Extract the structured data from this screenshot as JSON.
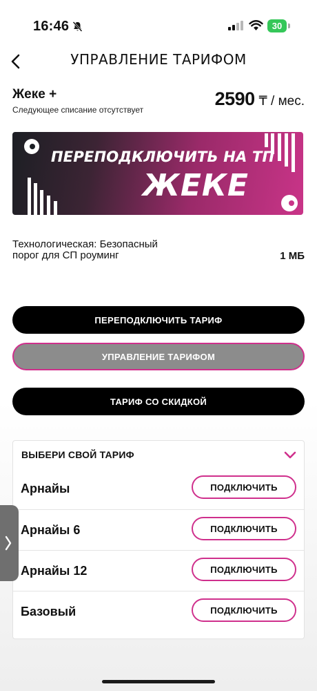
{
  "status_bar": {
    "time": "16:46",
    "battery": "30"
  },
  "header": {
    "title": "УПРАВЛЕНИЕ ТАРИФОМ"
  },
  "tariff": {
    "name": "Жеке +",
    "next_charge_note": "Следующее списание отсутствует",
    "price": "2590",
    "price_unit": "₸ / мес."
  },
  "banner": {
    "line1": "ПЕРЕПОДКЛЮЧИТЬ НА ТП",
    "line2": "ЖЕКЕ"
  },
  "tech_info": {
    "label": "Технологическая: Безопасный порог для СП роуминг",
    "value": "1 МБ"
  },
  "buttons": {
    "reconnect": "ПЕРЕПОДКЛЮЧИТЬ ТАРИФ",
    "manage": "УПРАВЛЕНИЕ ТАРИФОМ",
    "discount": "ТАРИФ СО СКИДКОЙ"
  },
  "choose_tariff": {
    "title": "ВЫБЕРИ СВОЙ ТАРИФ",
    "connect_label": "ПОДКЛЮЧИТЬ",
    "items": [
      {
        "name": "Арнайы"
      },
      {
        "name": "Арнайы 6"
      },
      {
        "name": "Арнайы 12"
      },
      {
        "name": "Базовый"
      }
    ]
  },
  "colors": {
    "accent": "#cf2f8c",
    "primary_button": "#000000",
    "disabled_button": "#8c8c8c",
    "battery": "#35c759"
  },
  "icons": [
    "bell-slash-icon",
    "signal-icon",
    "wifi-icon",
    "battery-icon",
    "back-chevron-icon",
    "chevron-down-icon",
    "chevron-right-icon"
  ]
}
